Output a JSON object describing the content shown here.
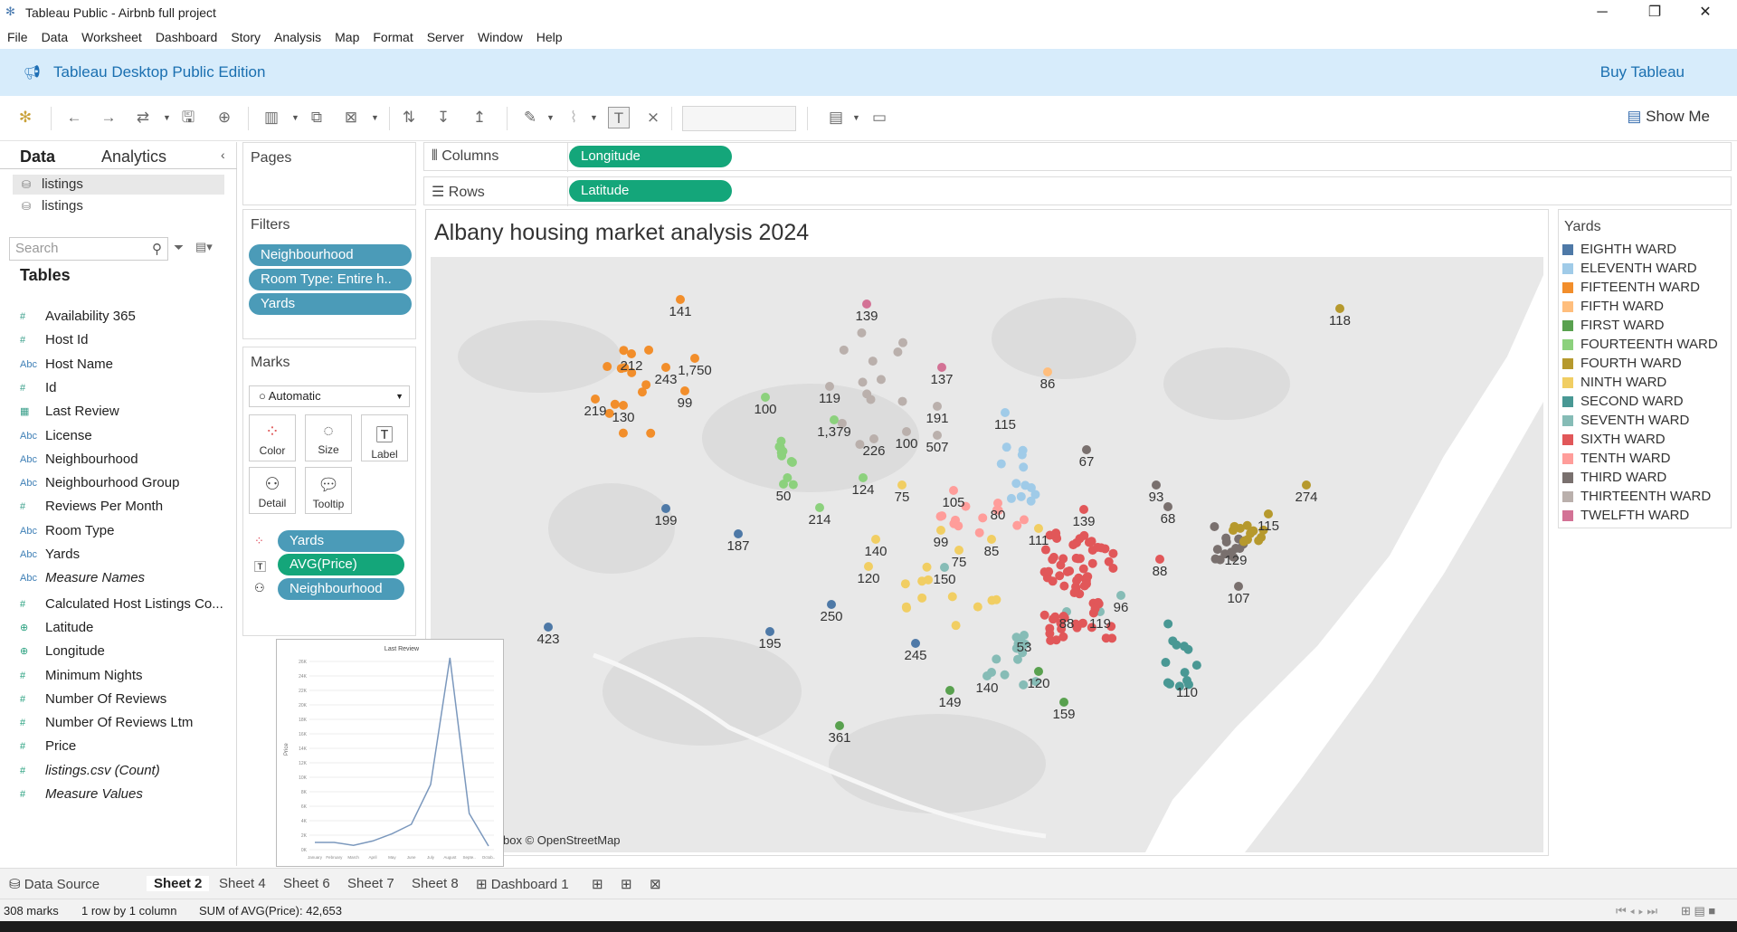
{
  "window": {
    "title": "Tableau Public - Airbnb full project"
  },
  "menu": [
    "File",
    "Data",
    "Worksheet",
    "Dashboard",
    "Story",
    "Analysis",
    "Map",
    "Format",
    "Server",
    "Window",
    "Help"
  ],
  "banner": {
    "edition": "Tableau Desktop Public Edition",
    "buy": "Buy Tableau"
  },
  "toolbar": {
    "show_me": "Show Me"
  },
  "data_pane": {
    "tab_data": "Data",
    "tab_analytics": "Analytics",
    "datasources": [
      "listings",
      "listings"
    ],
    "search_placeholder": "Search",
    "tables_header": "Tables",
    "fields": [
      {
        "type": "#",
        "name": "Availability 365"
      },
      {
        "type": "#",
        "name": "Host Id"
      },
      {
        "type": "Abc",
        "name": "Host Name"
      },
      {
        "type": "#",
        "name": "Id"
      },
      {
        "type": "date",
        "name": "Last Review"
      },
      {
        "type": "Abc",
        "name": "License"
      },
      {
        "type": "Abc",
        "name": "Neighbourhood"
      },
      {
        "type": "Abc",
        "name": "Neighbourhood Group"
      },
      {
        "type": "#",
        "name": "Reviews Per Month"
      },
      {
        "type": "Abc",
        "name": "Room Type"
      },
      {
        "type": "Abc",
        "name": "Yards"
      },
      {
        "type": "Abc",
        "name": "Measure Names"
      },
      {
        "type": "#",
        "name": "Calculated Host Listings Co..."
      },
      {
        "type": "geo",
        "name": "Latitude"
      },
      {
        "type": "geo",
        "name": "Longitude"
      },
      {
        "type": "#",
        "name": "Minimum Nights"
      },
      {
        "type": "#",
        "name": "Number Of Reviews"
      },
      {
        "type": "#",
        "name": "Number Of Reviews Ltm"
      },
      {
        "type": "#",
        "name": "Price"
      },
      {
        "type": "#",
        "name": "listings.csv (Count)"
      },
      {
        "type": "#",
        "name": "Measure Values"
      }
    ]
  },
  "shelves": {
    "pages": "Pages",
    "columns_label": "Columns",
    "rows_label": "Rows",
    "columns_pill": "Longitude",
    "rows_pill": "Latitude",
    "filters_title": "Filters",
    "filters": [
      "Neighbourhood",
      "Room Type: Entire h..",
      "Yards"
    ],
    "marks_title": "Marks",
    "mark_type": "Automatic",
    "mark_buttons": [
      "Color",
      "Size",
      "Label",
      "Detail",
      "Tooltip"
    ],
    "mark_pills": [
      "Yards",
      "AVG(Price)",
      "Neighbourhood"
    ]
  },
  "view": {
    "title": "Albany housing market analysis 2024",
    "attribution": "box © OpenStreetMap"
  },
  "legend": {
    "title": "Yards",
    "items": [
      {
        "name": "EIGHTH WARD",
        "color": "#4e79a7"
      },
      {
        "name": "ELEVENTH WARD",
        "color": "#a0cbe8"
      },
      {
        "name": "FIFTEENTH WARD",
        "color": "#f28e2b"
      },
      {
        "name": "FIFTH WARD",
        "color": "#ffbe7d"
      },
      {
        "name": "FIRST WARD",
        "color": "#59a14f"
      },
      {
        "name": "FOURTEENTH WARD",
        "color": "#8cd17d"
      },
      {
        "name": "FOURTH WARD",
        "color": "#b6992d"
      },
      {
        "name": "NINTH WARD",
        "color": "#f1ce63"
      },
      {
        "name": "SECOND WARD",
        "color": "#499894"
      },
      {
        "name": "SEVENTH WARD",
        "color": "#86bcb6"
      },
      {
        "name": "SIXTH WARD",
        "color": "#e15759"
      },
      {
        "name": "TENTH WARD",
        "color": "#ff9d9a"
      },
      {
        "name": "THIRD WARD",
        "color": "#79706e"
      },
      {
        "name": "THIRTEENTH WARD",
        "color": "#bab0ac"
      },
      {
        "name": "TWELFTH WARD",
        "color": "#d37295"
      }
    ]
  },
  "map_labels": [
    {
      "text": "141",
      "ward": "FIFTEENTH WARD"
    },
    {
      "text": "139",
      "ward": "TWELFTH WARD"
    },
    {
      "text": "118",
      "ward": "FOURTH WARD"
    },
    {
      "text": "212",
      "ward": "FIFTEENTH WARD"
    },
    {
      "text": "243",
      "ward": "FIFTEENTH WARD"
    },
    {
      "text": "1,750",
      "ward": "FIFTEENTH WARD"
    },
    {
      "text": "137",
      "ward": "TWELFTH WARD"
    },
    {
      "text": "86",
      "ward": "FIFTH WARD"
    },
    {
      "text": "219",
      "ward": "FIFTEENTH WARD"
    },
    {
      "text": "130",
      "ward": "FIFTEENTH WARD"
    },
    {
      "text": "99",
      "ward": "FIFTEENTH WARD"
    },
    {
      "text": "100",
      "ward": "FOURTEENTH WARD"
    },
    {
      "text": "119",
      "ward": "THIRTEENTH WARD"
    },
    {
      "text": "191",
      "ward": "THIRTEENTH WARD"
    },
    {
      "text": "115",
      "ward": "ELEVENTH WARD"
    },
    {
      "text": "1,379",
      "ward": "FOURTEENTH WARD"
    },
    {
      "text": "226",
      "ward": "THIRTEENTH WARD"
    },
    {
      "text": "100",
      "ward": "THIRTEENTH WARD"
    },
    {
      "text": "507",
      "ward": "THIRTEENTH WARD"
    },
    {
      "text": "67",
      "ward": "THIRD WARD"
    },
    {
      "text": "124",
      "ward": "FOURTEENTH WARD"
    },
    {
      "text": "75",
      "ward": "NINTH WARD"
    },
    {
      "text": "105",
      "ward": "TENTH WARD"
    },
    {
      "text": "80",
      "ward": "TENTH WARD"
    },
    {
      "text": "93",
      "ward": "THIRD WARD"
    },
    {
      "text": "274",
      "ward": "FOURTH WARD"
    },
    {
      "text": "50",
      "ward": "FOURTEENTH WARD"
    },
    {
      "text": "199",
      "ward": "EIGHTH WARD"
    },
    {
      "text": "214",
      "ward": "FOURTEENTH WARD"
    },
    {
      "text": "139",
      "ward": "SIXTH WARD"
    },
    {
      "text": "68",
      "ward": "THIRD WARD"
    },
    {
      "text": "115",
      "ward": "FOURTH WARD"
    },
    {
      "text": "187",
      "ward": "EIGHTH WARD"
    },
    {
      "text": "99",
      "ward": "NINTH WARD"
    },
    {
      "text": "111",
      "ward": "NINTH WARD"
    },
    {
      "text": "140",
      "ward": "NINTH WARD"
    },
    {
      "text": "85",
      "ward": "NINTH WARD"
    },
    {
      "text": "75",
      "ward": "NINTH WARD"
    },
    {
      "text": "129",
      "ward": "THIRD WARD"
    },
    {
      "text": "88",
      "ward": "SIXTH WARD"
    },
    {
      "text": "120",
      "ward": "NINTH WARD"
    },
    {
      "text": "150",
      "ward": "SEVENTH WARD"
    },
    {
      "text": "107",
      "ward": "THIRD WARD"
    },
    {
      "text": "250",
      "ward": "EIGHTH WARD"
    },
    {
      "text": "96",
      "ward": "SEVENTH WARD"
    },
    {
      "text": "88",
      "ward": "SEVENTH WARD"
    },
    {
      "text": "119",
      "ward": "SEVENTH WARD"
    },
    {
      "text": "423",
      "ward": "EIGHTH WARD"
    },
    {
      "text": "195",
      "ward": "EIGHTH WARD"
    },
    {
      "text": "53",
      "ward": "SEVENTH WARD"
    },
    {
      "text": "245",
      "ward": "EIGHTH WARD"
    },
    {
      "text": "140",
      "ward": "SEVENTH WARD"
    },
    {
      "text": "120",
      "ward": "FIRST WARD"
    },
    {
      "text": "110",
      "ward": "SECOND WARD"
    },
    {
      "text": "149",
      "ward": "FIRST WARD"
    },
    {
      "text": "159",
      "ward": "FIRST WARD"
    },
    {
      "text": "361",
      "ward": "FIRST WARD"
    }
  ],
  "popup_chart": {
    "title": "Last Review",
    "ylabel": "Price",
    "yticks": [
      "0K",
      "2K",
      "4K",
      "6K",
      "8K",
      "10K",
      "12K",
      "14K",
      "16K",
      "18K",
      "20K",
      "22K",
      "24K",
      "26K"
    ],
    "categories": [
      "January",
      "February",
      "March",
      "April",
      "May",
      "June",
      "July",
      "August",
      "Septe..",
      "Octob.."
    ],
    "values": [
      1000,
      1000,
      600,
      1200,
      2200,
      3500,
      9000,
      26500,
      5000,
      500
    ],
    "line_color": "#7b98bd"
  },
  "sheet_tabs": [
    "Data Source",
    "Sheet 2",
    "Sheet 4",
    "Sheet 6",
    "Sheet 7",
    "Sheet 8",
    "Dashboard 1"
  ],
  "active_sheet": "Sheet 2",
  "status": {
    "marks": "308 marks",
    "dims": "1 row by 1 column",
    "sum": "SUM of AVG(Price): 42,653"
  }
}
